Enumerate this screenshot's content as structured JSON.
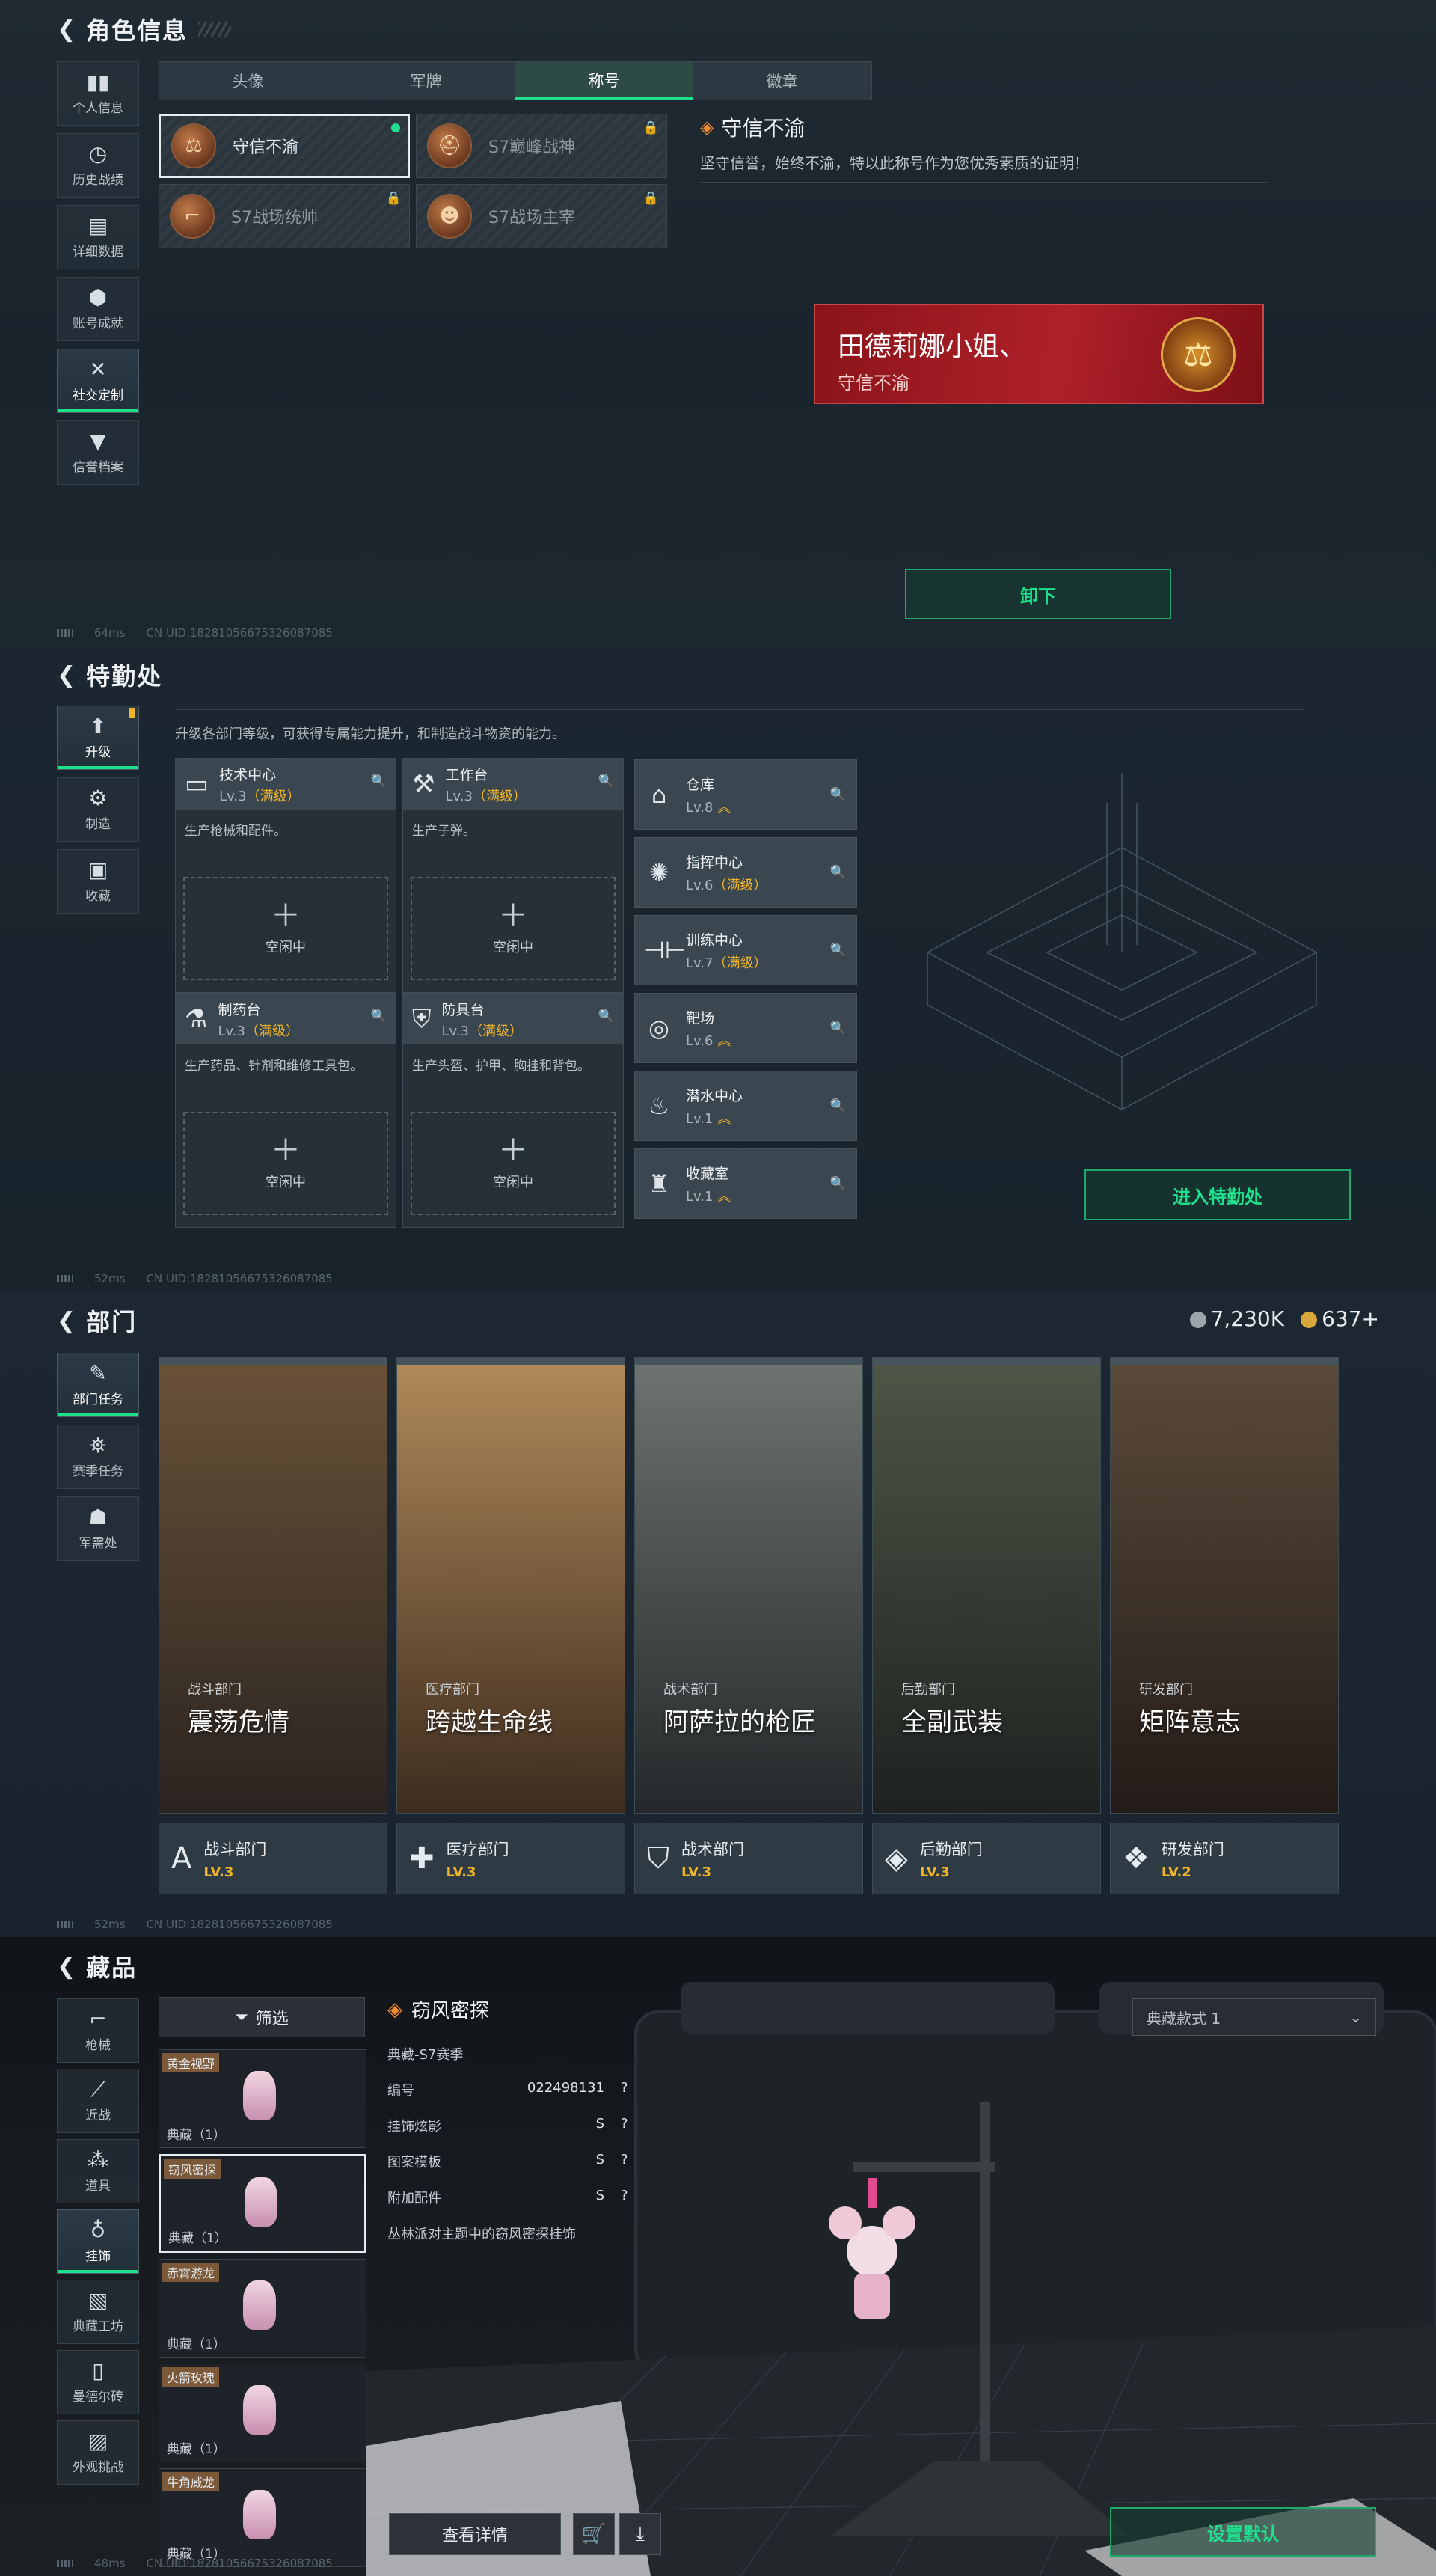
{
  "p1": {
    "title": "角色信息",
    "nav": [
      {
        "icon": "个人",
        "label": "个人信息"
      },
      {
        "icon": "◷",
        "label": "历史战绩"
      },
      {
        "icon": "▤",
        "label": "详细数据"
      },
      {
        "icon": "⬢",
        "label": "账号成就"
      },
      {
        "icon": "✕",
        "label": "社交定制"
      },
      {
        "icon": "▼",
        "label": "信誉档案"
      }
    ],
    "tabs": [
      "头像",
      "军牌",
      "称号",
      "徽章"
    ],
    "titles": [
      {
        "name": "守信不渝",
        "locked": false
      },
      {
        "name": "S7巅峰战神",
        "locked": true
      },
      {
        "name": "S7战场统帅",
        "locked": true
      },
      {
        "name": "S7战场主宰",
        "locked": true
      }
    ],
    "info_title": "守信不渝",
    "info_desc": "坚守信誉，始终不渝，特以此称号作为您优秀素质的证明！",
    "nameplate_name": "田德莉娜小姐、",
    "nameplate_title": "守信不渝",
    "unequip": "卸下",
    "ping": "64ms",
    "uid": "CN UID:18281056675326087085"
  },
  "p2": {
    "title": "特勤处",
    "nav": [
      {
        "icon": "⬆",
        "label": "升级"
      },
      {
        "icon": "⚙",
        "label": "制造"
      },
      {
        "icon": "▣",
        "label": "收藏"
      }
    ],
    "desc": "升级各部门等级，可获得专属能力提升，和制造战斗物资的能力。",
    "big": [
      {
        "name": "技术中心",
        "lv": "Lv.3",
        "max": "（满级）",
        "desc": "生产枪械和配件。",
        "idle": "空闲中",
        "icon": "▭"
      },
      {
        "name": "工作台",
        "lv": "Lv.3",
        "max": "（满级）",
        "desc": "生产子弹。",
        "idle": "空闲中",
        "icon": "⚒"
      },
      {
        "name": "制药台",
        "lv": "Lv.3",
        "max": "（满级）",
        "desc": "生产药品、针剂和维修工具包。",
        "idle": "空闲中",
        "icon": "⚗"
      },
      {
        "name": "防具台",
        "lv": "Lv.3",
        "max": "（满级）",
        "desc": "生产头盔、护甲、胸挂和背包。",
        "idle": "空闲中",
        "icon": "⛨"
      }
    ],
    "small": [
      {
        "name": "仓库",
        "lv": "Lv.8",
        "max": "",
        "icon": "⌂"
      },
      {
        "name": "指挥中心",
        "lv": "Lv.6",
        "max": "（满级）",
        "icon": "✺"
      },
      {
        "name": "训练中心",
        "lv": "Lv.7",
        "max": "（满级）",
        "icon": "⊣⊢"
      },
      {
        "name": "靶场",
        "lv": "Lv.6",
        "max": "",
        "icon": "◎"
      },
      {
        "name": "潜水中心",
        "lv": "Lv.1",
        "max": "",
        "icon": "♨"
      },
      {
        "name": "收藏室",
        "lv": "Lv.1",
        "max": "",
        "icon": "♜"
      }
    ],
    "enter": "进入特勤处",
    "ping": "52ms",
    "uid": "CN UID:18281056675326087085"
  },
  "p3": {
    "title": "部门",
    "nav": [
      {
        "icon": "✎",
        "label": "部门任务"
      },
      {
        "icon": "⛯",
        "label": "赛季任务"
      },
      {
        "icon": "☗",
        "label": "军需处"
      }
    ],
    "currency1": "7,230K",
    "currency2": "637+",
    "depts": [
      {
        "sub": "战斗部门",
        "name": "震荡危情",
        "bar": "战斗部门",
        "lv": "LV.3",
        "icon": "A",
        "c1": "#6a5238",
        "c2": "#2a2420"
      },
      {
        "sub": "医疗部门",
        "name": "跨越生命线",
        "bar": "医疗部门",
        "lv": "LV.3",
        "icon": "✚",
        "c1": "#b08a5a",
        "c2": "#3e2c1e"
      },
      {
        "sub": "战术部门",
        "name": "阿萨拉的枪匠",
        "bar": "战术部门",
        "lv": "LV.3",
        "icon": "⛉",
        "c1": "#6e7470",
        "c2": "#24282a"
      },
      {
        "sub": "后勤部门",
        "name": "全副武装",
        "bar": "后勤部门",
        "lv": "LV.3",
        "icon": "◈",
        "c1": "#4e5646",
        "c2": "#1e2220"
      },
      {
        "sub": "研发部门",
        "name": "矩阵意志",
        "bar": "研发部门",
        "lv": "LV.2",
        "icon": "❖",
        "c1": "#5a4a3a",
        "c2": "#241c18"
      }
    ],
    "ping": "52ms",
    "uid": "CN UID:18281056675326087085"
  },
  "p4": {
    "title": "藏品",
    "nav": [
      {
        "icon": "⌐",
        "label": "枪械"
      },
      {
        "icon": "⟋",
        "label": "近战"
      },
      {
        "icon": "⁂",
        "label": "道具"
      },
      {
        "icon": "♁",
        "label": "挂饰"
      },
      {
        "icon": "▧",
        "label": "典藏工坊"
      },
      {
        "icon": "▯",
        "label": "曼德尔砖"
      },
      {
        "icon": "▨",
        "label": "外观挑战"
      }
    ],
    "filter": "筛选",
    "items": [
      {
        "tag": "黄金视野",
        "count": "典藏（1）"
      },
      {
        "tag": "窃风密探",
        "count": "典藏（1）"
      },
      {
        "tag": "赤霄游龙",
        "count": "典藏（1）"
      },
      {
        "tag": "火箭玫瑰",
        "count": "典藏（1）"
      },
      {
        "tag": "牛角威龙",
        "count": "典藏（1）"
      }
    ],
    "detail_title": "窃风密探",
    "season": "典藏-S7赛季",
    "rows": [
      {
        "k": "编号",
        "v": "022498131",
        "q": "?"
      },
      {
        "k": "挂饰炫影",
        "v": "S",
        "q": "?"
      },
      {
        "k": "图案模板",
        "v": "S",
        "q": "?"
      },
      {
        "k": "附加配件",
        "v": "S",
        "q": "?"
      }
    ],
    "flavor": "丛林派对主题中的窃风密探挂饰",
    "style_select": "典藏款式 1",
    "view_detail": "查看详情",
    "set_default": "设置默认",
    "ping": "48ms",
    "uid": "CN UID:18281056675326087085"
  }
}
